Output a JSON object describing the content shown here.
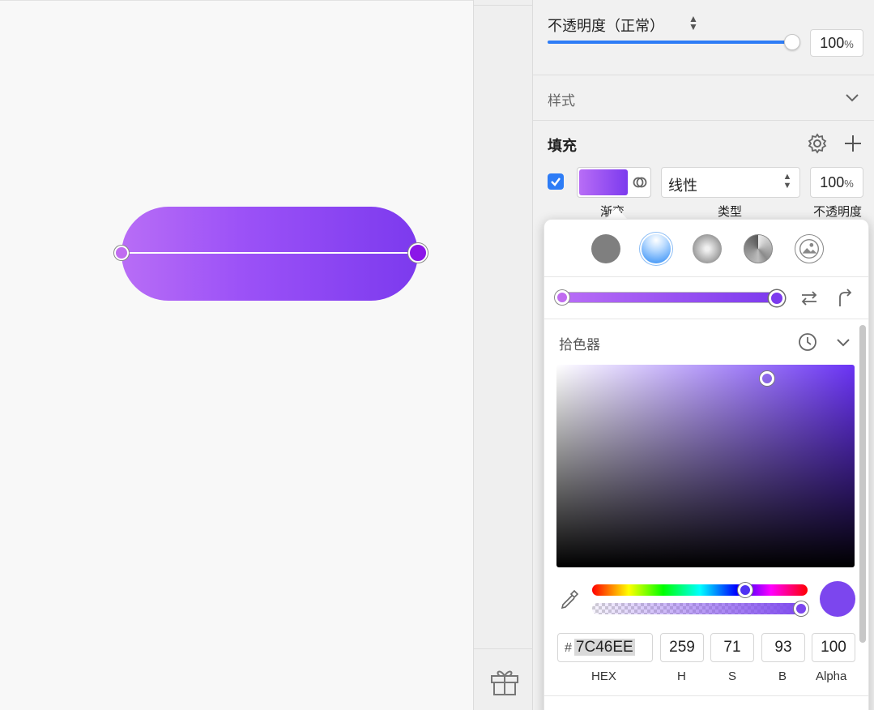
{
  "canvas": {
    "shape_fill": {
      "type": "linear-gradient",
      "start_color": "#B86DF6",
      "end_color": "#7C3AEE"
    }
  },
  "inspector": {
    "opacity": {
      "title": "不透明度（正常）",
      "value": "100",
      "unit": "%",
      "level": 1.0
    },
    "style_section": {
      "title": "样式"
    },
    "fill_section": {
      "title": "填充",
      "enabled": true,
      "type_value": "线性",
      "opacity_value": "100",
      "opacity_unit": "%",
      "captions": {
        "gradient": "渐变",
        "type": "类型",
        "opacity": "不透明度"
      }
    }
  },
  "color_popover": {
    "fill_types": [
      "solid-fill-icon",
      "linear-gradient-icon",
      "radial-gradient-icon",
      "angular-gradient-icon",
      "image-fill-icon"
    ],
    "selected_fill_type": "linear-gradient-icon",
    "picker_title": "拾色器",
    "fields": {
      "hash": "#",
      "hex": "7C46EE",
      "h": "259",
      "s": "71",
      "b": "93",
      "alpha": "100"
    },
    "field_labels": {
      "hex": "HEX",
      "h": "H",
      "s": "S",
      "b": "B",
      "alpha": "Alpha"
    },
    "current_color": "#7C46EE"
  }
}
